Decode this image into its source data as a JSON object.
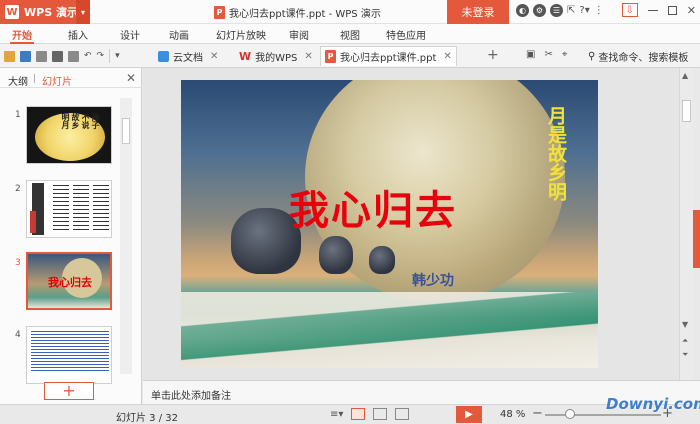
{
  "titlebar": {
    "app_name": "WPS 演示",
    "doc_title": "我心归去ppt课件.ppt - WPS 演示",
    "login_label": "未登录"
  },
  "ribbon": {
    "tabs": [
      "开始",
      "插入",
      "设计",
      "动画",
      "幻灯片放映",
      "审阅",
      "视图",
      "特色应用"
    ]
  },
  "doctabs": {
    "cloud": "云文档",
    "mywps": "我的WPS",
    "current": "我心归去ppt课件.ppt"
  },
  "search": {
    "label": "查找命令、搜索模板"
  },
  "leftpanel": {
    "tab_outline": "大纲",
    "tab_slides": "幻灯片",
    "thumbs": [
      {
        "num": "1"
      },
      {
        "num": "2"
      },
      {
        "num": "3"
      },
      {
        "num": "4"
      }
    ],
    "add_label": "+"
  },
  "slide": {
    "title": "我心归去",
    "vertical": "月是故乡明",
    "author": "韩少功"
  },
  "thumb1_text": [
    "海子",
    "不说",
    "故乡",
    "明月"
  ],
  "thumb3_title": "我心归去",
  "notes": {
    "placeholder": "单击此处添加备注"
  },
  "status": {
    "slide_count": "幻灯片 3 / 32",
    "zoom": "48 %"
  },
  "watermark": "Downyi.com",
  "colors": {
    "accent": "#e4593b",
    "title_red": "#e8000d",
    "vertical_yellow": "#f0e23a"
  }
}
